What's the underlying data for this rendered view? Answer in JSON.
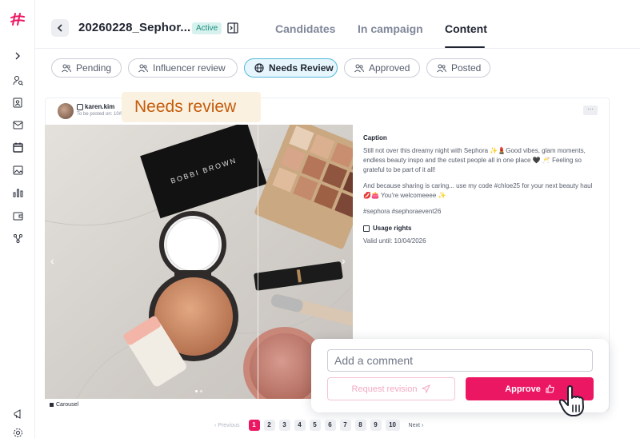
{
  "sidebar": {
    "icons": [
      "logo-icon",
      "chevron-right-icon",
      "user-search-icon",
      "contact-card-icon",
      "mail-icon",
      "calendar-icon",
      "image-icon",
      "bar-chart-icon",
      "wallet-icon",
      "network-icon",
      "megaphone-icon",
      "gear-icon"
    ]
  },
  "header": {
    "title": "20260228_Sephor...",
    "status": "Active",
    "tabs": [
      {
        "label": "Candidates"
      },
      {
        "label": "In campaign"
      },
      {
        "label": "Content"
      }
    ]
  },
  "filters": [
    {
      "label": "Pending"
    },
    {
      "label": "Influencer review"
    },
    {
      "label": "Needs Review"
    },
    {
      "label": "Approved"
    },
    {
      "label": "Posted"
    }
  ],
  "post": {
    "handle": "karen.kim",
    "posted_on": "To be posted on: 10/04",
    "more": "···",
    "tooltip": "Needs review",
    "media_type": "Carousel",
    "image_labels": {
      "palette_brand": "BOBBI BROWN"
    },
    "caption": {
      "title": "Caption",
      "paragraph1": "Still not over this dreamy night with Sephora ✨💄Good vibes, glam moments, endless beauty inspo and the cutest people all in one place 🖤 🥂 Feeling so grateful to be part of it all!",
      "paragraph2": "And because sharing is caring... use my code #chloe25 for your next beauty haul 💋👛 You're welcomeeee ✨",
      "hashtags": "#sephora #sephoraevent26"
    },
    "usage_rights": {
      "title": "Usage rights",
      "valid_until": "Valid until: 10/04/2026"
    }
  },
  "review": {
    "comment_placeholder": "Add a comment",
    "request_revision_label": "Request revision",
    "approve_label": "Approve"
  },
  "pagination": {
    "previous": "Previous",
    "pages": [
      "1",
      "2",
      "3",
      "4",
      "5",
      "6",
      "7",
      "8",
      "9",
      "10"
    ],
    "current": "1",
    "next": "Next"
  },
  "colors": {
    "accent": "#ec1763",
    "badge_bg": "#d7f2ee",
    "badge_text": "#1b8c7c",
    "selected_pill_border": "#56b8dd",
    "tooltip_bg": "#fbf1e0",
    "tooltip_text": "#c45c0b"
  }
}
